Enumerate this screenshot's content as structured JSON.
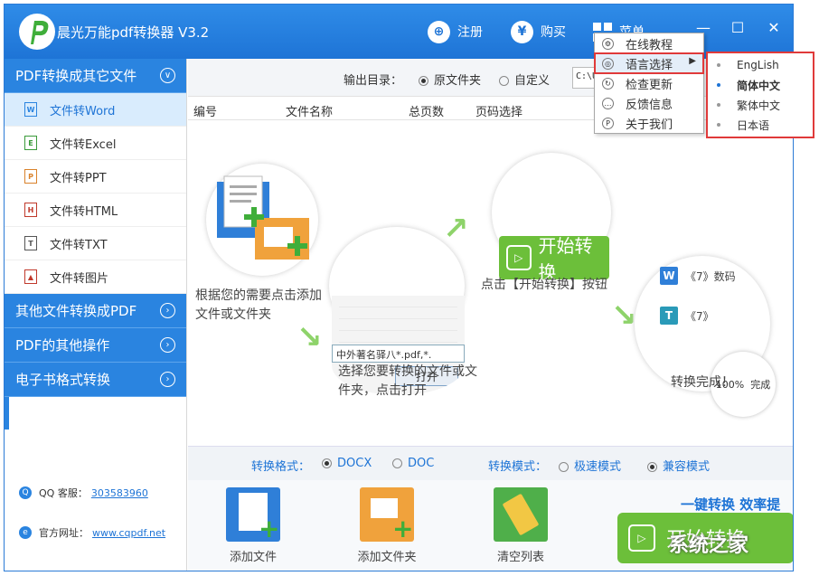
{
  "app": {
    "title": "晨光万能pdf转换器 V3.2"
  },
  "titlebar": {
    "register": "注册",
    "buy": "购买",
    "menu": "菜单",
    "minimize": "—",
    "maximize": "☐",
    "close": "✕"
  },
  "sidebar": {
    "categories": [
      {
        "label": "PDF转换成其它文件"
      },
      {
        "label": "其他文件转换成PDF"
      },
      {
        "label": "PDF的其他操作"
      },
      {
        "label": "电子书格式转换"
      }
    ],
    "items": [
      {
        "label": "文件转Word",
        "icon": "W"
      },
      {
        "label": "文件转Excel",
        "icon": "E"
      },
      {
        "label": "文件转PPT",
        "icon": "P"
      },
      {
        "label": "文件转HTML",
        "icon": "H"
      },
      {
        "label": "文件转TXT",
        "icon": "T"
      },
      {
        "label": "文件转图片",
        "icon": "▲"
      }
    ],
    "qq_label": "QQ 客服：",
    "qq_value": "303583960",
    "site_label": "官方网址：",
    "site_value": "www.cqpdf.net"
  },
  "output": {
    "label": "输出目录：",
    "option_original": "原文件夹",
    "option_custom": "自定义",
    "path": "C:\\U"
  },
  "table": {
    "columns": [
      "编号",
      "文件名称",
      "总页数",
      "页码选择"
    ]
  },
  "guide": {
    "step1": "根据您的需要点击添加文件或文件夹",
    "step2": "选择您要转换的文件或文件夹，点击打开",
    "step3": "点击【开始转换】按钮",
    "step4": "转换完成！",
    "start_label": "开始转换",
    "dialog_file": "中外著名驿八*.pdf,*.",
    "dialog_open": "打开",
    "file1": "《7》数码",
    "file2": "《7》",
    "progress": "100%",
    "progress_text": "完成"
  },
  "format": {
    "label": "转换格式：",
    "opt1": "DOCX",
    "opt2": "DOC",
    "mode_label": "转换模式：",
    "mode1": "极速模式",
    "mode2": "兼容模式"
  },
  "toolbar": {
    "add_file": "添加文件",
    "add_folder": "添加文件夹",
    "clear_list": "清空列表",
    "slogan": "一键转换  效率提",
    "start": "开始转换"
  },
  "menu": {
    "items": [
      "在线教程",
      "语言选择",
      "检查更新",
      "反馈信息",
      "关于我们"
    ]
  },
  "language": {
    "items": [
      "EngLish",
      "简体中文",
      "繁体中文",
      "日本语"
    ],
    "selected": "简体中文"
  },
  "watermark": "系统之家",
  "colors": {
    "primary": "#2a84e0",
    "green": "#6cbf3a",
    "highlight": "#e03a3a"
  }
}
